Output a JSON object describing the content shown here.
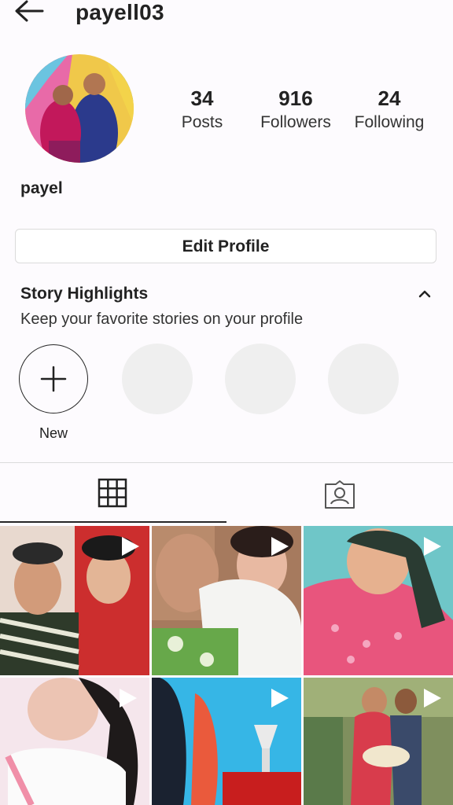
{
  "header": {
    "username": "payell03",
    "back_icon": "arrow-left-icon"
  },
  "profile": {
    "display_name": "payel",
    "stats": [
      {
        "value": "34",
        "label": "Posts"
      },
      {
        "value": "916",
        "label": "Followers"
      },
      {
        "value": "24",
        "label": "Following"
      }
    ],
    "edit_button_label": "Edit Profile"
  },
  "highlights": {
    "title": "Story Highlights",
    "subtitle": "Keep your favorite stories on your profile",
    "new_label": "New",
    "collapse_icon": "chevron-up-icon"
  },
  "tabs": [
    {
      "icon": "grid-icon",
      "active": true
    },
    {
      "icon": "tagged-icon",
      "active": false
    }
  ],
  "posts": [
    {
      "type": "video",
      "bg": "#c0392b"
    },
    {
      "type": "video",
      "bg": "#8fb36a"
    },
    {
      "type": "video",
      "bg": "#e3558a"
    },
    {
      "type": "video",
      "bg": "#f2e3ea"
    },
    {
      "type": "video",
      "bg": "#2fb4e8"
    },
    {
      "type": "video",
      "bg": "#6f7a5a"
    }
  ]
}
